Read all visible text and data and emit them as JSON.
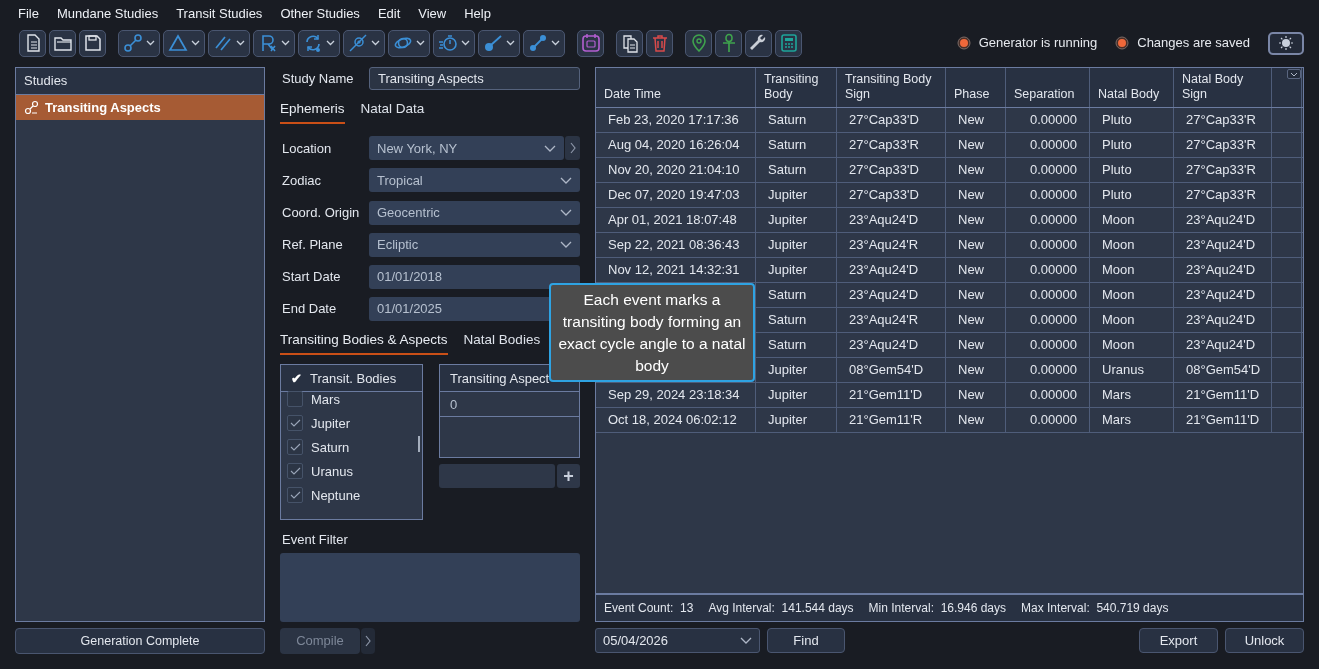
{
  "menu": [
    "File",
    "Mundane Studies",
    "Transit Studies",
    "Other Studies",
    "Edit",
    "View",
    "Help"
  ],
  "status": [
    {
      "label": "Generator is running",
      "on": true
    },
    {
      "label": "Changes are saved",
      "on": true
    }
  ],
  "studies": {
    "title": "Studies",
    "items": [
      {
        "label": "Transiting Aspects",
        "selected": true
      }
    ],
    "footer_button": "Generation Complete"
  },
  "study_name": {
    "label": "Study Name",
    "value": "Transiting Aspects"
  },
  "tabs": [
    {
      "label": "Ephemeris",
      "selected": true
    },
    {
      "label": "Natal Data",
      "selected": false
    }
  ],
  "fields": [
    {
      "label": "Location",
      "value": "New York, NY",
      "kind": "dropdown-more"
    },
    {
      "label": "Zodiac",
      "value": "Tropical",
      "kind": "dropdown"
    },
    {
      "label": "Coord. Origin",
      "value": "Geocentric",
      "kind": "dropdown"
    },
    {
      "label": "Ref. Plane",
      "value": "Ecliptic",
      "kind": "dropdown"
    },
    {
      "label": "Start Date",
      "value": "01/01/2018",
      "kind": "date"
    },
    {
      "label": "End Date",
      "value": "01/01/2025",
      "kind": "date"
    }
  ],
  "lower_tabs": [
    {
      "label": "Transiting Bodies & Aspects",
      "selected": true
    },
    {
      "label": "Natal Bodies",
      "selected": false
    }
  ],
  "bodies": {
    "header": "Transit. Bodies",
    "header_mark": "✔",
    "items": [
      {
        "label": "Mars",
        "checked": false
      },
      {
        "label": "Jupiter",
        "checked": true
      },
      {
        "label": "Saturn",
        "checked": true
      },
      {
        "label": "Uranus",
        "checked": true
      },
      {
        "label": "Neptune",
        "checked": true
      }
    ]
  },
  "aspects": {
    "header": "Transiting Aspect",
    "items": [
      "0"
    ],
    "add_button": "+"
  },
  "event_filter": {
    "label": "Event Filter"
  },
  "compile": {
    "label": "Compile",
    "disabled": true
  },
  "table": {
    "columns": [
      [
        "Date Time"
      ],
      [
        "Transiting",
        "Body"
      ],
      [
        "Transiting Body",
        "Sign"
      ],
      [
        "Phase"
      ],
      [
        "Separation"
      ],
      [
        "Natal Body"
      ],
      [
        "Natal Body",
        "Sign"
      ]
    ],
    "rows": [
      {
        "date_time": "Feb 23, 2020 17:17:36",
        "transiting_body": "Saturn",
        "transiting_body_sign": "27°Cap33'D",
        "phase": "New",
        "separation": "0.00000",
        "natal_body": "Pluto",
        "natal_body_sign": "27°Cap33'R"
      },
      {
        "date_time": "Aug 04, 2020 16:26:04",
        "transiting_body": "Saturn",
        "transiting_body_sign": "27°Cap33'R",
        "phase": "New",
        "separation": "0.00000",
        "natal_body": "Pluto",
        "natal_body_sign": "27°Cap33'R"
      },
      {
        "date_time": "Nov 20, 2020 21:04:10",
        "transiting_body": "Saturn",
        "transiting_body_sign": "27°Cap33'D",
        "phase": "New",
        "separation": "0.00000",
        "natal_body": "Pluto",
        "natal_body_sign": "27°Cap33'R"
      },
      {
        "date_time": "Dec 07, 2020 19:47:03",
        "transiting_body": "Jupiter",
        "transiting_body_sign": "27°Cap33'D",
        "phase": "New",
        "separation": "0.00000",
        "natal_body": "Pluto",
        "natal_body_sign": "27°Cap33'R"
      },
      {
        "date_time": "Apr 01, 2021 18:07:48",
        "transiting_body": "Jupiter",
        "transiting_body_sign": "23°Aqu24'D",
        "phase": "New",
        "separation": "0.00000",
        "natal_body": "Moon",
        "natal_body_sign": "23°Aqu24'D"
      },
      {
        "date_time": "Sep 22, 2021 08:36:43",
        "transiting_body": "Jupiter",
        "transiting_body_sign": "23°Aqu24'R",
        "phase": "New",
        "separation": "0.00000",
        "natal_body": "Moon",
        "natal_body_sign": "23°Aqu24'D"
      },
      {
        "date_time": "Nov 12, 2021 14:32:31",
        "transiting_body": "Jupiter",
        "transiting_body_sign": "23°Aqu24'D",
        "phase": "New",
        "separation": "0.00000",
        "natal_body": "Moon",
        "natal_body_sign": "23°Aqu24'D"
      },
      {
        "transiting_body": "Saturn",
        "transiting_body_sign": "23°Aqu24'D",
        "phase": "New",
        "separation": "0.00000",
        "natal_body": "Moon",
        "natal_body_sign": "23°Aqu24'D"
      },
      {
        "transiting_body": "Saturn",
        "transiting_body_sign": "23°Aqu24'R",
        "phase": "New",
        "separation": "0.00000",
        "natal_body": "Moon",
        "natal_body_sign": "23°Aqu24'D"
      },
      {
        "transiting_body": "Saturn",
        "transiting_body_sign": "23°Aqu24'D",
        "phase": "New",
        "separation": "0.00000",
        "natal_body": "Moon",
        "natal_body_sign": "23°Aqu24'D"
      },
      {
        "transiting_body": "Jupiter",
        "transiting_body_sign": "08°Gem54'D",
        "phase": "New",
        "separation": "0.00000",
        "natal_body": "Uranus",
        "natal_body_sign": "08°Gem54'D"
      },
      {
        "date_time": "Sep 29, 2024 23:18:34",
        "transiting_body": "Jupiter",
        "transiting_body_sign": "21°Gem11'D",
        "phase": "New",
        "separation": "0.00000",
        "natal_body": "Mars",
        "natal_body_sign": "21°Gem11'D"
      },
      {
        "date_time": "Oct 18, 2024 06:02:12",
        "transiting_body": "Jupiter",
        "transiting_body_sign": "21°Gem11'R",
        "phase": "New",
        "separation": "0.00000",
        "natal_body": "Mars",
        "natal_body_sign": "21°Gem11'D"
      }
    ]
  },
  "stats": [
    {
      "label": "Event Count:",
      "value": "13"
    },
    {
      "label": "Avg Interval:",
      "value": "141.544 days"
    },
    {
      "label": "Min Interval:",
      "value": "16.946 days"
    },
    {
      "label": "Max Interval:",
      "value": "540.719 days"
    }
  ],
  "date_picker": "05/04/2026",
  "buttons": {
    "find": "Find",
    "export": "Export",
    "unlock": "Unlock"
  },
  "tooltip": "Each event marks a transiting body forming an exact cycle angle to a natal body"
}
